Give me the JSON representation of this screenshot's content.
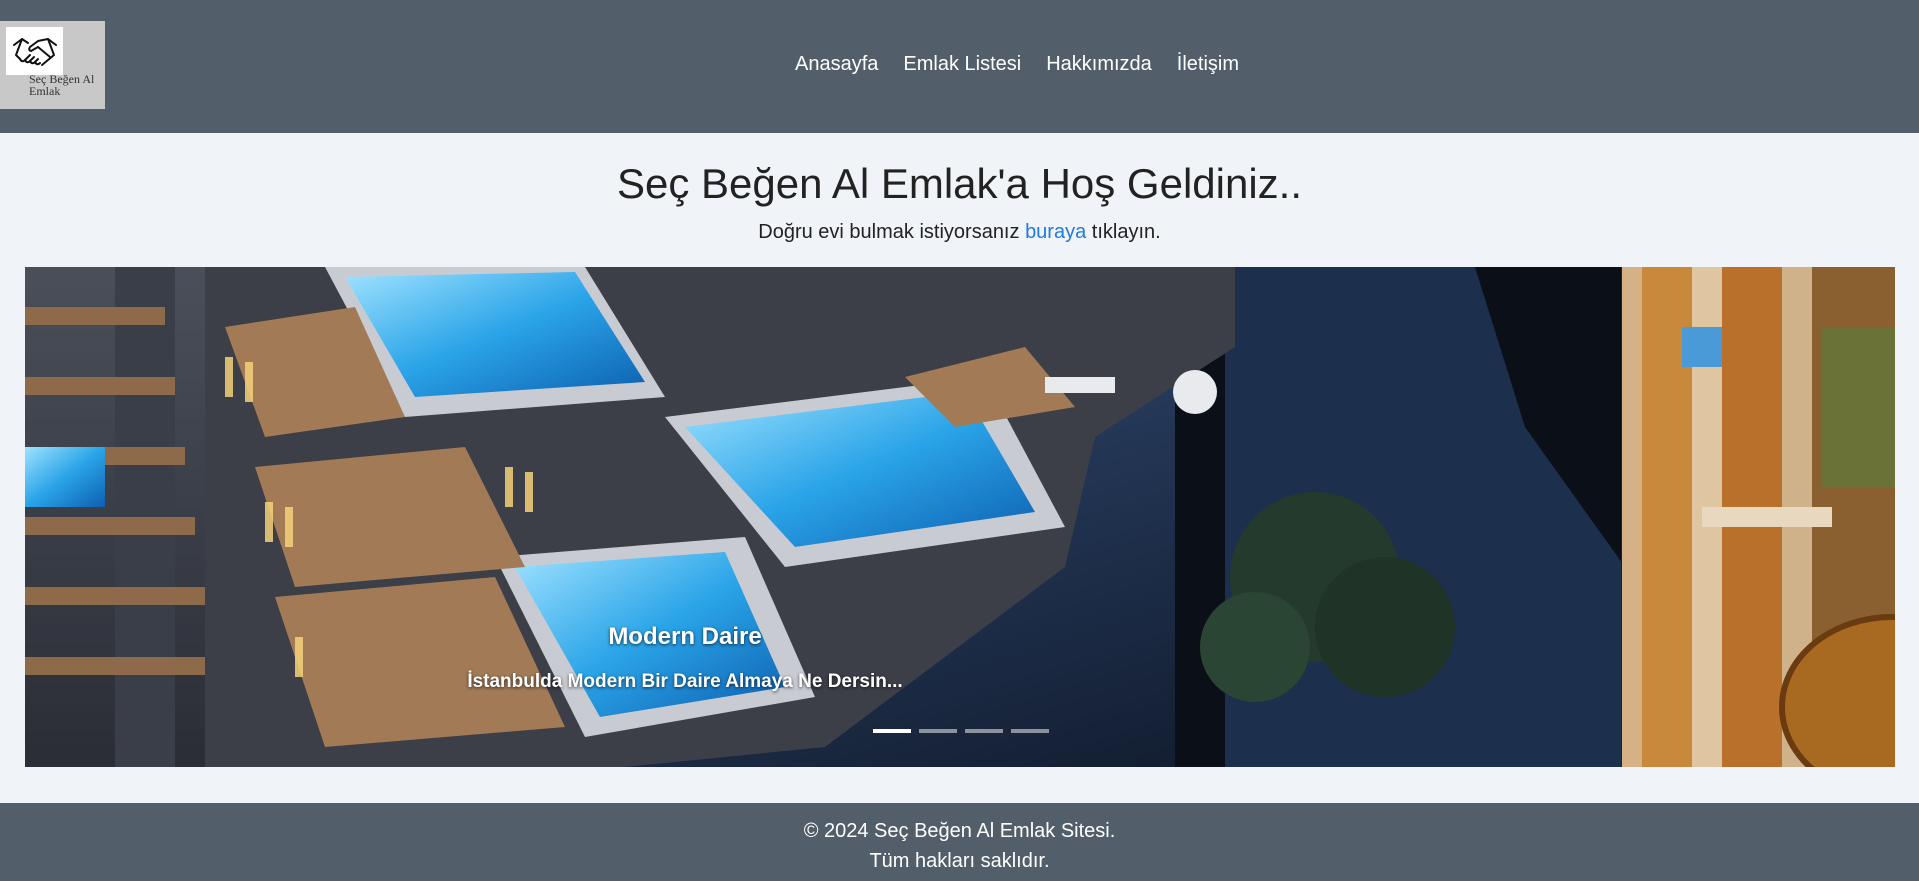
{
  "brand": {
    "logo_text": "Seç Beğen Al Emlak",
    "logo_icon": "handshake-icon"
  },
  "nav": {
    "items": [
      {
        "label": "Anasayfa"
      },
      {
        "label": "Emlak Listesi"
      },
      {
        "label": "Hakkımızda"
      },
      {
        "label": "İletişim"
      }
    ]
  },
  "hero": {
    "title": "Seç Beğen Al Emlak'a Hoş Geldiniz..",
    "subtitle_before": "Doğru evi bulmak istiyorsanız ",
    "subtitle_link": "buraya",
    "subtitle_after": " tıklayın."
  },
  "carousel": {
    "active_index": 0,
    "slide_count": 4,
    "caption_title": "Modern Daire",
    "caption_text": "İstanbulda Modern Bir Daire Almaya Ne Dersin..."
  },
  "footer": {
    "line1": "© 2024 Seç Beğen Al Emlak Sitesi.",
    "line2": "Tüm hakları saklıdır."
  },
  "colors": {
    "header_bg": "#525f6b",
    "page_bg": "#f0f4f8",
    "link": "#1e7be0"
  }
}
